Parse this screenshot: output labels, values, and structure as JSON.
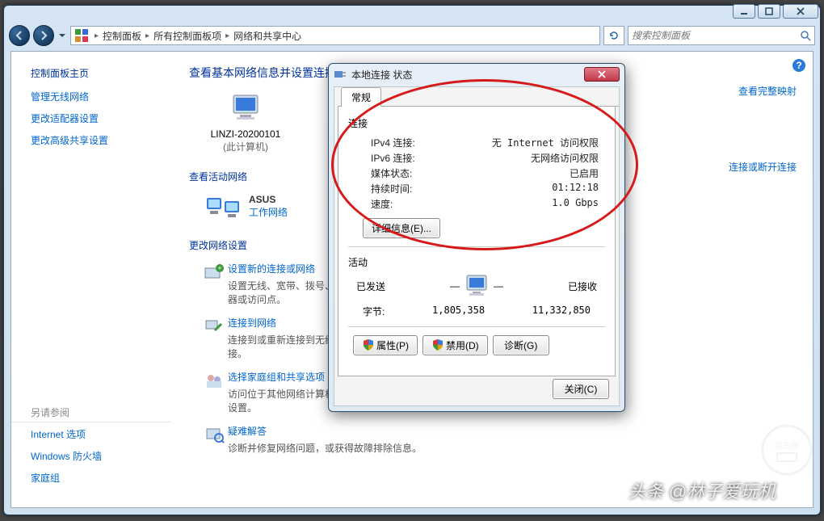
{
  "titlebar": {},
  "breadcrumb": {
    "root": "控制面板",
    "mid": "所有控制面板项",
    "leaf": "网络和共享中心"
  },
  "search": {
    "placeholder": "搜索控制面板"
  },
  "sidebar": {
    "home": "控制面板主页",
    "links": [
      "管理无线网络",
      "更改适配器设置",
      "更改高级共享设置"
    ],
    "see_also_title": "另请参阅",
    "see_also": [
      "Internet 选项",
      "Windows 防火墙",
      "家庭组"
    ]
  },
  "main": {
    "heading": "查看基本网络信息并设置连接",
    "computer_name": "LINZI-20200101",
    "computer_sub": "(此计算机)",
    "right_link_map": "查看完整映射",
    "right_link_conn": "连接或断开连接",
    "active_title": "查看活动网络",
    "network_name": "ASUS",
    "network_type": "工作网络",
    "change_title": "更改网络设置",
    "task1": {
      "title": "设置新的连接或网络",
      "desc": "设置无线、宽带、拨号、临时或 VPN 连接；或设置路由器或访问点。"
    },
    "task2": {
      "title": "连接到网络",
      "desc": "连接到或重新连接到无线、有线、拨号或 VPN 网络连接。"
    },
    "task3": {
      "title": "选择家庭组和共享选项",
      "desc": "访问位于其他网络计算机上的文件和打印机，或更改共享设置。"
    },
    "task4": {
      "title": "疑难解答",
      "desc": "诊断并修复网络问题，或获得故障排除信息。"
    }
  },
  "dlg": {
    "title": "本地连接 状态",
    "tab": "常规",
    "conn_title": "连接",
    "rows": {
      "ipv4_k": "IPv4 连接:",
      "ipv4_v": "无 Internet 访问权限",
      "ipv6_k": "IPv6 连接:",
      "ipv6_v": "无网络访问权限",
      "media_k": "媒体状态:",
      "media_v": "已启用",
      "dur_k": "持续时间:",
      "dur_v": "01:12:18",
      "spd_k": "速度:",
      "spd_v": "1.0 Gbps"
    },
    "details_btn": "详细信息(E)...",
    "activity_title": "活动",
    "sent_label": "已发送",
    "recv_label": "已接收",
    "bytes_label": "字节:",
    "bytes_sent": "1,805,358",
    "bytes_recv": "11,332,850",
    "props_btn": "属性(P)",
    "disable_btn": "禁用(D)",
    "diag_btn": "诊断(G)",
    "close_btn": "关闭(C)"
  },
  "watermark": "头条 @林子爱玩机"
}
